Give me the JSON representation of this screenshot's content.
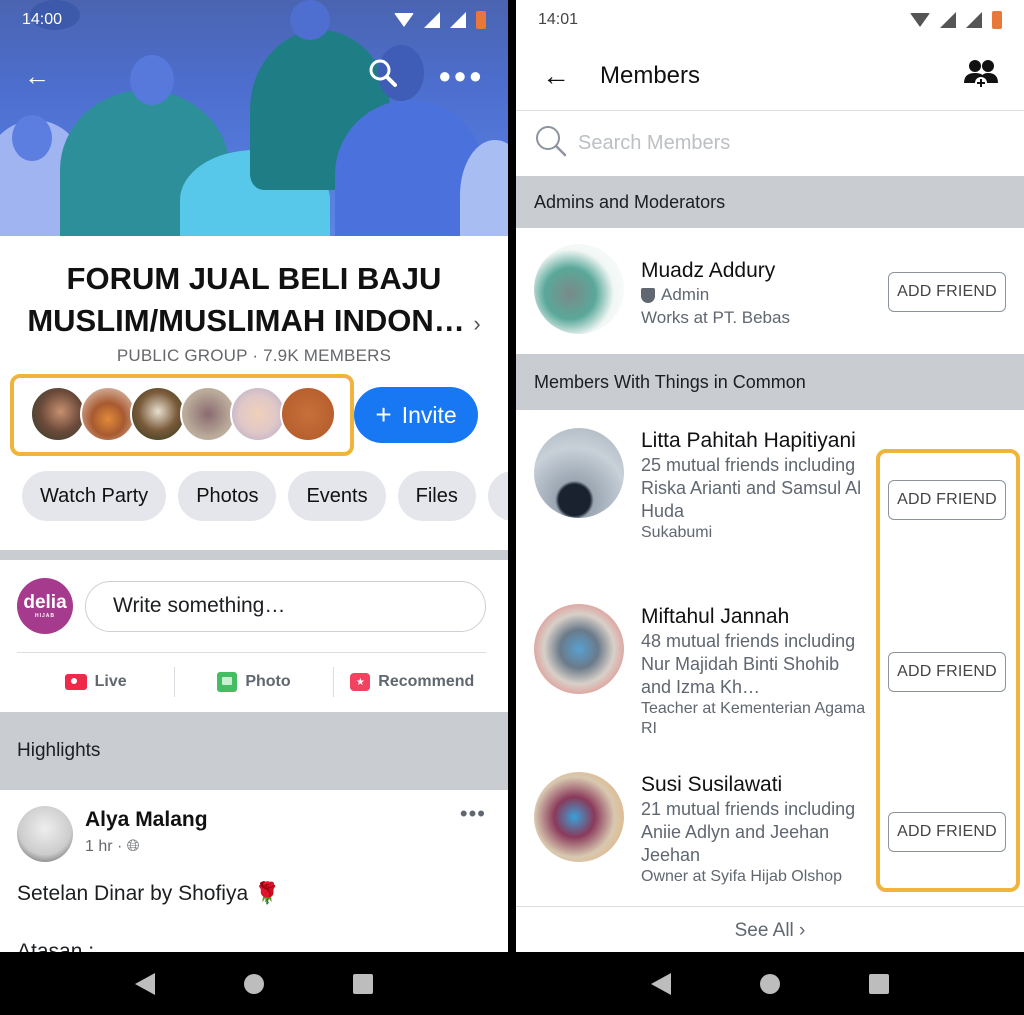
{
  "left_screen": {
    "status_bar": {
      "time": "14:00"
    },
    "toolbar": {
      "back_icon": "arrow-left",
      "search_icon": "magnifier",
      "more_icon": "ellipsis"
    },
    "group": {
      "title": "FORUM JUAL BELI BAJU MUSLIM/MUSLIMAH INDON…",
      "title_chevron": "›",
      "meta": "PUBLIC GROUP · 7.9K MEMBERS",
      "member_avatars_count": 6,
      "invite_label": "Invite",
      "invite_plus": "+"
    },
    "chips": [
      "Watch Party",
      "Photos",
      "Events",
      "Files"
    ],
    "composer": {
      "avatar_text": "delia",
      "avatar_subtext": "HIJAB",
      "placeholder": "Write something…"
    },
    "actions": [
      {
        "label": "Live",
        "icon": "live-video"
      },
      {
        "label": "Photo",
        "icon": "photo"
      },
      {
        "label": "Recommend",
        "icon": "recommend"
      }
    ],
    "highlights_label": "Highlights",
    "post": {
      "author": "Alya Malang",
      "time": "1 hr ·",
      "privacy_icon": "globe",
      "more": "•••",
      "text": "Setelan Dinar by Shofiya 🌹",
      "text_cut": "Atasan :"
    }
  },
  "right_screen": {
    "status_bar": {
      "time": "14:01"
    },
    "header": {
      "title": "Members",
      "back_icon": "arrow-left",
      "action_icon": "add-members"
    },
    "search": {
      "placeholder": "Search Members",
      "value": ""
    },
    "sections": [
      {
        "title": "Admins and Moderators",
        "members": [
          {
            "name": "Muadz Addury",
            "role": "Admin",
            "detail": "Works at PT. Bebas",
            "button": "ADD FRIEND"
          }
        ]
      },
      {
        "title": "Members With Things in Common",
        "members": [
          {
            "name": "Litta Pahitah Hapitiyani",
            "mutual": "25 mutual friends including Riska Arianti and Samsul Al Huda",
            "detail": "Sukabumi",
            "button": "ADD FRIEND"
          },
          {
            "name": "Miftahul Jannah",
            "mutual": "48 mutual friends including Nur Majidah Binti Shohib and Izma Kh…",
            "detail": "Teacher at Kementerian Agama RI",
            "button": "ADD FRIEND"
          },
          {
            "name": "Susi Susilawati",
            "mutual": "21 mutual friends including Aniie Adlyn and Jeehan Jeehan",
            "detail": "Owner at Syifa Hijab Olshop",
            "button": "ADD FRIEND"
          }
        ]
      }
    ],
    "see_all": "See All",
    "see_all_chevron": "›"
  },
  "colors": {
    "accent_blue": "#1877f2",
    "highlight_box": "#f0b43c",
    "section_gray": "#c9ccd1",
    "chip_gray": "#e4e6eb"
  }
}
